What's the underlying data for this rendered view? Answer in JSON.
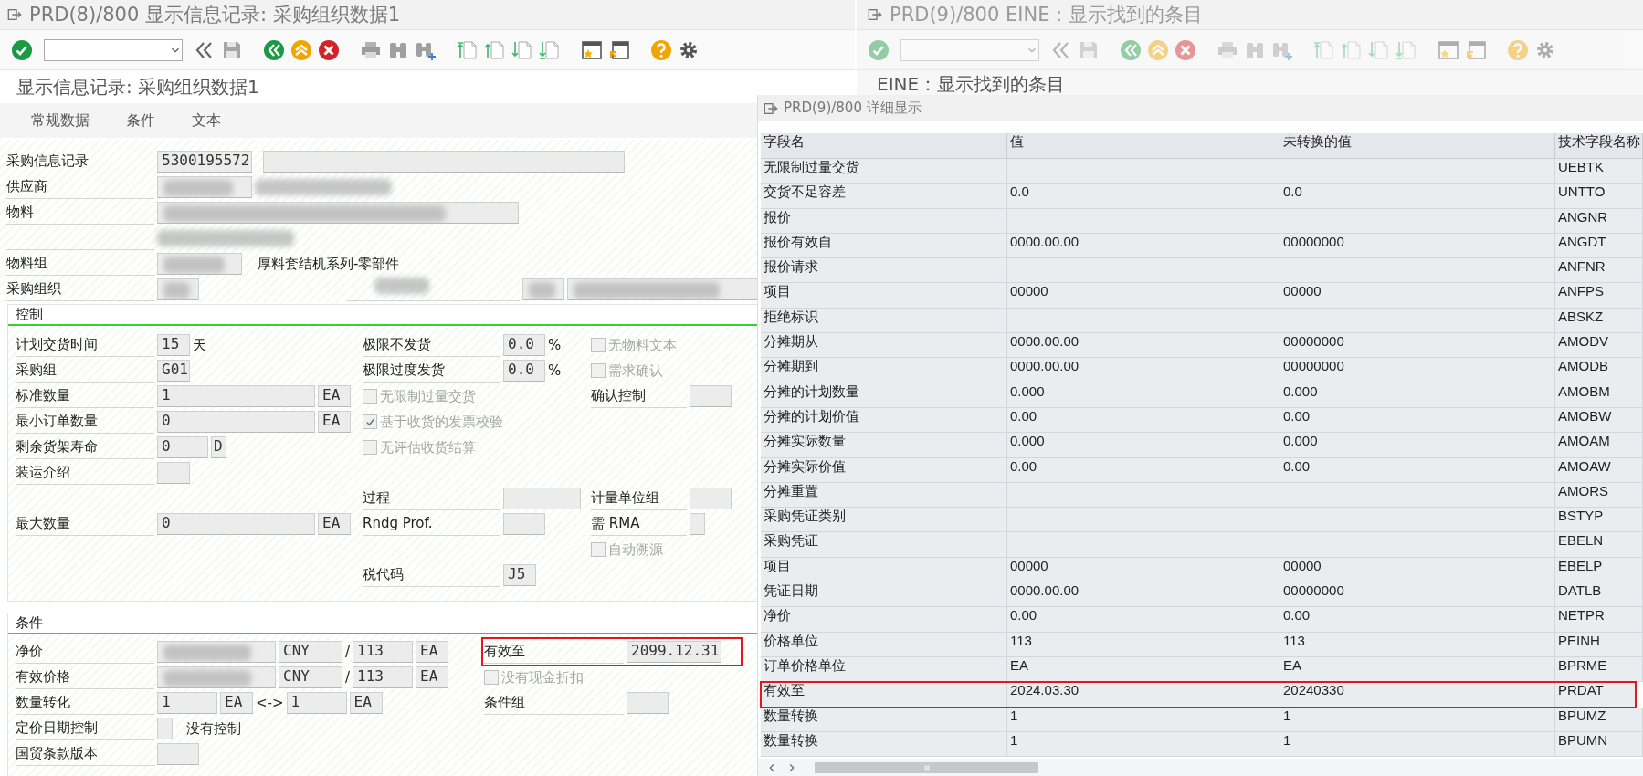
{
  "left_window": {
    "title": "PRD(8)/800 显示信息记录: 采购组织数据1",
    "active": true,
    "screen_title": "显示信息记录: 采购组织数据1",
    "tabs": [
      {
        "label": "常规数据",
        "selected": false
      },
      {
        "label": "条件",
        "selected": false
      },
      {
        "label": "文本",
        "selected": false
      }
    ],
    "header_rows": [
      {
        "left": {
          "kind": "field",
          "label": "采购信息记录",
          "items": [
            {
              "kind": "input",
              "value": "5300195572"
            },
            {
              "kind": "input"
            }
          ]
        }
      },
      {
        "left": {
          "kind": "field",
          "label": "供应商",
          "items": [
            {
              "kind": "input",
              "redacted": true
            },
            {
              "kind": "text",
              "redacted": true
            }
          ]
        }
      },
      {
        "left": {
          "kind": "field",
          "label": "物料",
          "items": [
            {
              "kind": "input",
              "redacted": true
            }
          ]
        }
      },
      {
        "left": {
          "kind": "field",
          "items": [
            {
              "kind": "text",
              "redacted": true
            }
          ]
        }
      },
      {
        "left": {
          "kind": "field",
          "label": "物料组",
          "items": [
            {
              "kind": "input",
              "redacted": true
            },
            {
              "kind": "text",
              "text": "厚料套结机系列-零部件"
            }
          ]
        }
      },
      {
        "left": {
          "kind": "field",
          "label": "采购组织",
          "items": [
            {
              "kind": "input",
              "redacted": true
            }
          ]
        },
        "right": {
          "kind": "field",
          "redacted": true,
          "items": [
            {
              "kind": "input",
              "redacted": true
            },
            {
              "kind": "input",
              "redacted": true
            }
          ]
        }
      }
    ],
    "sections": [
      {
        "kind": "control",
        "title": "控制",
        "rows": [
          {
            "left": {
              "kind": "field",
              "label": "计划交货时间",
              "items": [
                {
                  "kind": "input",
                  "value": "15"
                },
                {
                  "kind": "text",
                  "text": "天"
                }
              ]
            },
            "middle": {
              "kind": "field",
              "label": "极限不发货",
              "items": [
                {
                  "kind": "input",
                  "value": "0.0"
                },
                {
                  "kind": "text",
                  "text": "%"
                }
              ]
            },
            "right": {
              "kind": "check",
              "label": "无物料文本",
              "checked": false,
              "disabled": true
            }
          },
          {
            "left": {
              "kind": "field",
              "label": "采购组",
              "items": [
                {
                  "kind": "input",
                  "value": "G01"
                }
              ]
            },
            "middle": {
              "kind": "field",
              "label": "极限过度发货",
              "items": [
                {
                  "kind": "input",
                  "value": "0.0"
                },
                {
                  "kind": "text",
                  "text": "%"
                }
              ]
            },
            "right": {
              "kind": "check",
              "label": "需求确认",
              "checked": false,
              "disabled": true
            }
          },
          {
            "left": {
              "kind": "field",
              "label": "标准数量",
              "items": [
                {
                  "kind": "input",
                  "value": "1"
                },
                {
                  "kind": "input",
                  "value": "EA"
                }
              ]
            },
            "middle": {
              "kind": "check",
              "label": "无限制过量交货",
              "checked": false,
              "disabled": true
            },
            "right": {
              "kind": "field",
              "label": "确认控制",
              "items": [
                {
                  "kind": "input"
                }
              ]
            }
          },
          {
            "left": {
              "kind": "field",
              "label": "最小订单数量",
              "items": [
                {
                  "kind": "input",
                  "value": "0"
                },
                {
                  "kind": "input",
                  "value": "EA"
                }
              ]
            },
            "middle": {
              "kind": "check",
              "label": "基于收货的发票校验",
              "checked": true,
              "disabled": true
            }
          },
          {
            "left": {
              "kind": "field",
              "label": "剩余货架寿命",
              "items": [
                {
                  "kind": "input",
                  "value": "0"
                },
                {
                  "kind": "input",
                  "value": "D"
                }
              ]
            },
            "middle": {
              "kind": "check",
              "label": "无评估收货结算",
              "checked": false,
              "disabled": true
            }
          },
          {
            "left": {
              "kind": "field",
              "label": "装运介绍",
              "items": [
                {
                  "kind": "input"
                }
              ]
            }
          },
          {
            "middle": {
              "kind": "field",
              "label": "过程",
              "items": [
                {
                  "kind": "input"
                }
              ]
            },
            "right": {
              "kind": "field",
              "label": "计量单位组",
              "items": [
                {
                  "kind": "input"
                }
              ]
            }
          },
          {
            "left": {
              "kind": "field",
              "label": "最大数量",
              "items": [
                {
                  "kind": "input",
                  "value": "0"
                },
                {
                  "kind": "input",
                  "value": "EA"
                }
              ]
            },
            "middle": {
              "kind": "field",
              "label": "Rndg Prof.",
              "items": [
                {
                  "kind": "input"
                }
              ]
            },
            "right": {
              "kind": "field",
              "label": "需 RMA",
              "items": [
                {
                  "kind": "input"
                }
              ]
            }
          },
          {
            "right": {
              "kind": "check",
              "label": "自动溯源",
              "checked": false,
              "disabled": true
            }
          },
          {
            "middle": {
              "kind": "field",
              "label": "税代码",
              "items": [
                {
                  "kind": "input",
                  "value": "J5"
                }
              ]
            }
          }
        ]
      },
      {
        "kind": "conditions",
        "title": "条件",
        "rows": [
          {
            "left": {
              "kind": "field",
              "label": "净价",
              "items": [
                {
                  "kind": "input",
                  "redacted": true
                },
                {
                  "kind": "input",
                  "value": "CNY"
                },
                {
                  "kind": "text",
                  "text": "/"
                },
                {
                  "kind": "input",
                  "value": "113"
                },
                {
                  "kind": "input",
                  "value": "EA"
                }
              ]
            },
            "right": {
              "kind": "field",
              "label": "有效至",
              "highlighted": true,
              "items": [
                {
                  "kind": "input",
                  "value": "2099.12.31"
                }
              ]
            }
          },
          {
            "left": {
              "kind": "field",
              "label": "有效价格",
              "items": [
                {
                  "kind": "input",
                  "redacted": true
                },
                {
                  "kind": "input",
                  "value": "CNY"
                },
                {
                  "kind": "text",
                  "text": "/"
                },
                {
                  "kind": "input",
                  "value": "113"
                },
                {
                  "kind": "input",
                  "value": "EA"
                }
              ]
            },
            "right": {
              "kind": "check",
              "label": "没有现金折扣",
              "checked": false,
              "disabled": true
            }
          },
          {
            "left": {
              "kind": "field",
              "label": "数量转化",
              "items": [
                {
                  "kind": "input",
                  "value": "1"
                },
                {
                  "kind": "input",
                  "value": "EA"
                },
                {
                  "kind": "text",
                  "text": "<->"
                },
                {
                  "kind": "input",
                  "value": "1"
                },
                {
                  "kind": "input",
                  "value": "EA"
                }
              ]
            },
            "right": {
              "kind": "field",
              "label": "条件组",
              "items": [
                {
                  "kind": "input"
                }
              ]
            }
          },
          {
            "left": {
              "kind": "field",
              "label": "定价日期控制",
              "items": [
                {
                  "kind": "input"
                },
                {
                  "kind": "text",
                  "text": "没有控制"
                }
              ]
            }
          },
          {
            "left": {
              "kind": "field",
              "label": "国贸条款版本",
              "items": [
                {
                  "kind": "input"
                }
              ]
            }
          }
        ]
      }
    ]
  },
  "right_window": {
    "title": "PRD(9)/800 EINE：显示找到的条目",
    "active": false,
    "screen_title": "EINE：显示找到的条目"
  },
  "detail_popup": {
    "title": "PRD(9)/800 详细显示",
    "columns": [
      "字段名",
      "值",
      "未转换的值",
      "技术字段名称"
    ],
    "rows": [
      {
        "field": "无限制过量交货",
        "technical_name": "UEBTK",
        "highlighted": false
      },
      {
        "field": "交货不足容差",
        "value": "0.0",
        "unconverted": "0.0",
        "technical_name": "UNTTO",
        "highlighted": false
      },
      {
        "field": "报价",
        "technical_name": "ANGNR",
        "highlighted": false
      },
      {
        "field": "报价有效自",
        "value": "0000.00.00",
        "unconverted": "00000000",
        "technical_name": "ANGDT",
        "highlighted": false
      },
      {
        "field": "报价请求",
        "technical_name": "ANFNR",
        "highlighted": false
      },
      {
        "field": "项目",
        "value": "00000",
        "unconverted": "00000",
        "technical_name": "ANFPS",
        "highlighted": false
      },
      {
        "field": "拒绝标识",
        "technical_name": "ABSKZ",
        "highlighted": false
      },
      {
        "field": "分摊期从",
        "value": "0000.00.00",
        "unconverted": "00000000",
        "technical_name": "AMODV",
        "highlighted": false
      },
      {
        "field": "分摊期到",
        "value": "0000.00.00",
        "unconverted": "00000000",
        "technical_name": "AMODB",
        "highlighted": false
      },
      {
        "field": "分摊的计划数量",
        "value": "0.000",
        "unconverted": "0.000",
        "technical_name": "AMOBM",
        "highlighted": false
      },
      {
        "field": "分摊的计划价值",
        "value": "0.00",
        "unconverted": "0.00",
        "technical_name": "AMOBW",
        "highlighted": false
      },
      {
        "field": "分摊实际数量",
        "value": "0.000",
        "unconverted": "0.000",
        "technical_name": "AMOAM",
        "highlighted": false
      },
      {
        "field": "分摊实际价值",
        "value": "0.00",
        "unconverted": "0.00",
        "technical_name": "AMOAW",
        "highlighted": false
      },
      {
        "field": "分摊重置",
        "technical_name": "AMORS",
        "highlighted": false
      },
      {
        "field": "采购凭证类别",
        "technical_name": "BSTYP",
        "highlighted": false
      },
      {
        "field": "采购凭证",
        "technical_name": "EBELN",
        "highlighted": false
      },
      {
        "field": "项目",
        "value": "00000",
        "unconverted": "00000",
        "technical_name": "EBELP",
        "highlighted": false
      },
      {
        "field": "凭证日期",
        "value": "0000.00.00",
        "unconverted": "00000000",
        "technical_name": "DATLB",
        "highlighted": false
      },
      {
        "field": "净价",
        "value": "0.00",
        "unconverted": "0.00",
        "technical_name": "NETPR",
        "highlighted": false
      },
      {
        "field": "价格单位",
        "value": "113",
        "unconverted": "113",
        "technical_name": "PEINH",
        "highlighted": false
      },
      {
        "field": "订单价格单位",
        "value": "EA",
        "unconverted": "EA",
        "technical_name": "BPRME",
        "highlighted": false
      },
      {
        "field": "有效至",
        "value": "2024.03.30",
        "unconverted": "20240330",
        "technical_name": "PRDAT",
        "highlighted": true
      },
      {
        "field": "数量转换",
        "value": "1",
        "unconverted": "1",
        "technical_name": "BPUMZ",
        "highlighted": false
      },
      {
        "field": "数量转换",
        "value": "1",
        "unconverted": "1",
        "technical_name": "BPUMN",
        "highlighted": false
      }
    ]
  }
}
